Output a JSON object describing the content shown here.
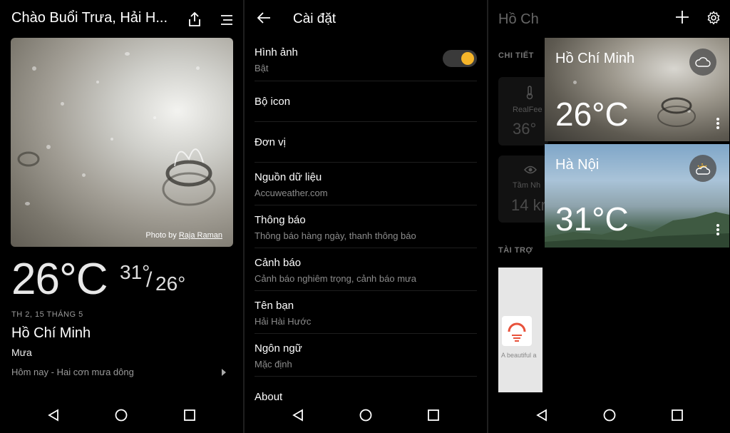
{
  "panel1": {
    "title": "Chào Buổi Trưa, Hải H...",
    "photo_credit_prefix": "Photo by ",
    "photo_credit_author": "Raja Raman",
    "temperature": "26°C",
    "high": "31°",
    "slash": "/",
    "low": "26°",
    "date": "TH 2, 15 THÁNG 5",
    "city": "Hồ Chí Minh",
    "condition": "Mưa",
    "forecast": "Hôm nay - Hai cơn mưa dông"
  },
  "panel2": {
    "title": "Cài đặt",
    "items": [
      {
        "title": "Hình ảnh",
        "subtitle": "Bật"
      },
      {
        "title": "Bộ icon",
        "subtitle": ""
      },
      {
        "title": "Đơn vị",
        "subtitle": ""
      },
      {
        "title": "Nguồn dữ liệu",
        "subtitle": "Accuweather.com"
      },
      {
        "title": "Thông báo",
        "subtitle": "Thông báo hàng ngày, thanh thông báo"
      },
      {
        "title": "Cảnh báo",
        "subtitle": "Cảnh báo nghiêm trọng, cảnh báo mưa"
      },
      {
        "title": "Tên bạn",
        "subtitle": "Hải Hài Hước"
      },
      {
        "title": "Ngôn ngữ",
        "subtitle": "Mặc định"
      },
      {
        "title": "About",
        "subtitle": ""
      }
    ],
    "toggle_on": true,
    "accent_color": "#f5b52a"
  },
  "panel3": {
    "bg_title": "Hồ Ch",
    "details_label": "CHI TIẾT",
    "realfeel_label": "RealFee",
    "realfeel_value": "36°",
    "visibility_label": "Tầm Nh",
    "visibility_value": "14 kr",
    "sponsor_label": "TÀI TRỢ",
    "ad_text": "A beautiful a",
    "locations": [
      {
        "city": "Hồ Chí Minh",
        "temperature": "26°C",
        "icon": "cloud-icon"
      },
      {
        "city": "Hà Nội",
        "temperature": "31°C",
        "icon": "partly-cloudy-icon"
      }
    ]
  }
}
